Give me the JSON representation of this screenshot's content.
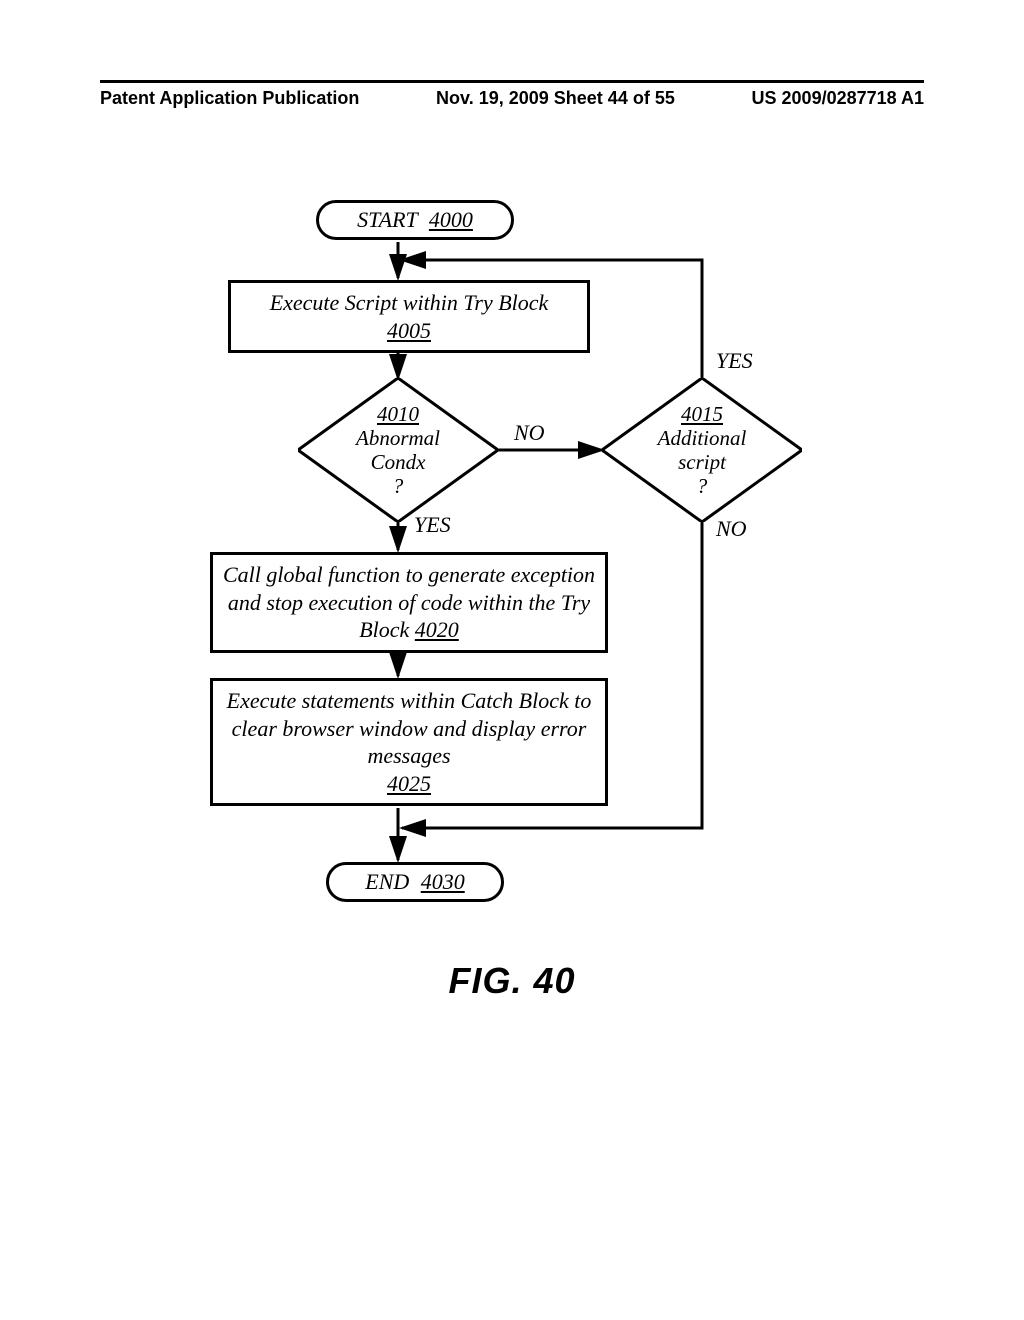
{
  "header": {
    "left": "Patent Application Publication",
    "center": "Nov. 19, 2009  Sheet 44 of 55",
    "right": "US 2009/0287718 A1"
  },
  "flowchart": {
    "start": {
      "label": "START",
      "num": "4000"
    },
    "step1": {
      "text": "Execute Script within Try Block",
      "num": "4005"
    },
    "dec1": {
      "num": "4010",
      "l1": "Abnormal",
      "l2": "Condx",
      "l3": "?"
    },
    "dec2": {
      "num": "4015",
      "l1": "Additional",
      "l2": "script",
      "l3": "?"
    },
    "step2": {
      "text": "Call global function to generate exception and stop execution of code within the Try Block",
      "num": "4020"
    },
    "step3": {
      "text": "Execute statements within Catch Block to clear browser window and display error messages",
      "num": "4025"
    },
    "end": {
      "label": "END",
      "num": "4030"
    },
    "labels": {
      "yes": "YES",
      "no": "NO"
    }
  },
  "figure": "FIG. 40",
  "chart_data": {
    "type": "flowchart",
    "nodes": [
      {
        "id": "4000",
        "type": "terminator",
        "text": "START"
      },
      {
        "id": "4005",
        "type": "process",
        "text": "Execute Script within Try Block"
      },
      {
        "id": "4010",
        "type": "decision",
        "text": "Abnormal Condx?"
      },
      {
        "id": "4015",
        "type": "decision",
        "text": "Additional script?"
      },
      {
        "id": "4020",
        "type": "process",
        "text": "Call global function to generate exception and stop execution of code within the Try Block"
      },
      {
        "id": "4025",
        "type": "process",
        "text": "Execute statements within Catch Block to clear browser window and display error messages"
      },
      {
        "id": "4030",
        "type": "terminator",
        "text": "END"
      }
    ],
    "edges": [
      {
        "from": "4000",
        "to": "4005"
      },
      {
        "from": "4005",
        "to": "4010"
      },
      {
        "from": "4010",
        "to": "4015",
        "label": "NO"
      },
      {
        "from": "4010",
        "to": "4020",
        "label": "YES"
      },
      {
        "from": "4015",
        "to": "4005",
        "label": "YES"
      },
      {
        "from": "4015",
        "to": "4030",
        "label": "NO"
      },
      {
        "from": "4020",
        "to": "4025"
      },
      {
        "from": "4025",
        "to": "4030"
      }
    ]
  }
}
